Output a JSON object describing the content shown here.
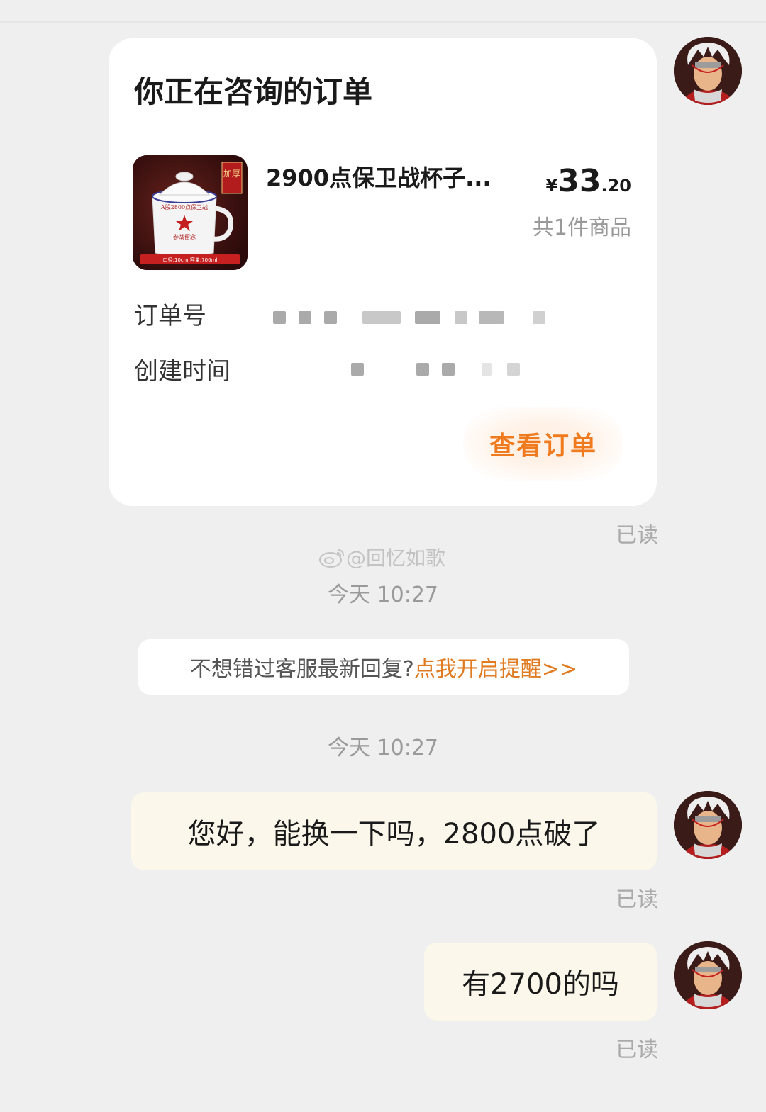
{
  "order_card": {
    "title": "你正在咨询的订单",
    "product_name": "2900点保卫战杯子...",
    "price_symbol": "¥",
    "price_integer": "33",
    "price_decimal": ".20",
    "item_count": "共1件商品",
    "order_no_label": "订单号",
    "created_label": "创建时间",
    "view_button": "查看订单",
    "product_image": {
      "badge": "加厚",
      "mug_text": "A股2800点保卫战",
      "mug_subtext": "参战留念",
      "bottom_banner": "口径:10cm  容量:700ml"
    }
  },
  "messages": [
    {
      "read": "已读"
    },
    {
      "text": "您好，能换一下吗，2800点破了",
      "read": "已读"
    },
    {
      "text": "有2700的吗",
      "read": "已读"
    }
  ],
  "watermark": "@回忆如歌",
  "timestamps": [
    "今天 10:27",
    "今天 10:27"
  ],
  "notify": {
    "text": "不想错过客服最新回复?",
    "link": "点我开启提醒>>"
  },
  "colors": {
    "background": "#efefef",
    "accent": "#f07a1e",
    "bubble": "#fbf7ea"
  }
}
